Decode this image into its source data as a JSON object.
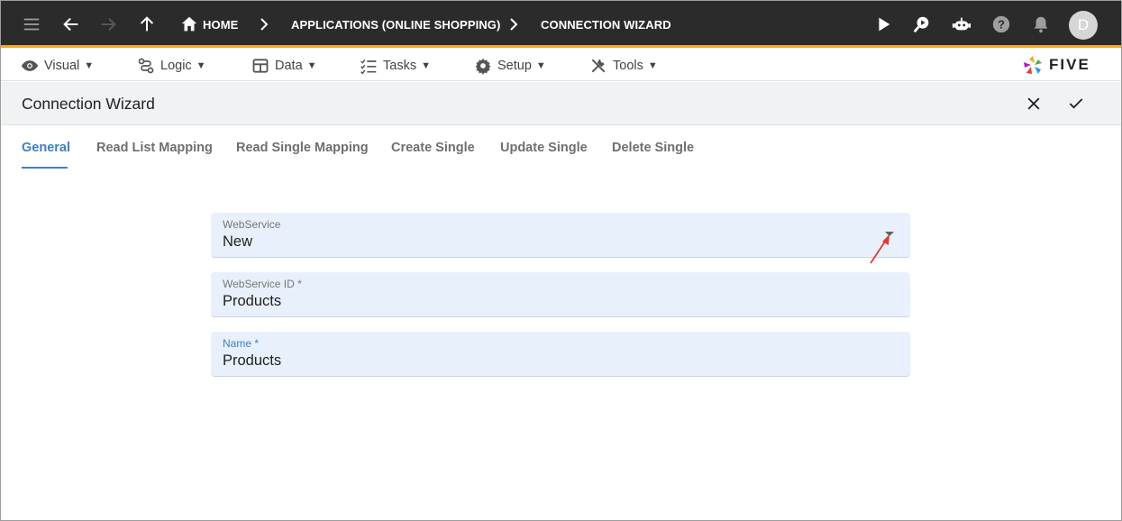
{
  "appbar": {
    "breadcrumbs": [
      {
        "label": "HOME"
      },
      {
        "label": "APPLICATIONS (ONLINE SHOPPING)"
      },
      {
        "label": "CONNECTION WIZARD"
      }
    ],
    "avatar_initial": "D",
    "icons": [
      "menu-icon",
      "back-arrow-icon",
      "forward-arrow-icon",
      "up-arrow-icon",
      "home-icon",
      "play-icon",
      "search-chat-icon",
      "bot-icon",
      "help-icon",
      "bell-icon"
    ]
  },
  "menubar": {
    "items": [
      {
        "label": "Visual",
        "icon": "eye-icon"
      },
      {
        "label": "Logic",
        "icon": "logic-icon"
      },
      {
        "label": "Data",
        "icon": "table-icon"
      },
      {
        "label": "Tasks",
        "icon": "checklist-icon"
      },
      {
        "label": "Setup",
        "icon": "gear-icon"
      },
      {
        "label": "Tools",
        "icon": "tools-icon"
      }
    ],
    "caret": "▼",
    "logo_text": "FIVE"
  },
  "header": {
    "title": "Connection Wizard"
  },
  "tabs": [
    {
      "label": "General",
      "active": true
    },
    {
      "label": "Read List Mapping"
    },
    {
      "label": "Read Single Mapping"
    },
    {
      "label": "Create Single"
    },
    {
      "label": "Update Single"
    },
    {
      "label": "Delete Single"
    }
  ],
  "form": {
    "webservice": {
      "label": "WebService",
      "value": "New"
    },
    "webservice_id": {
      "label": "WebService ID *",
      "value": "Products"
    },
    "name": {
      "label": "Name *",
      "value": "Products"
    }
  },
  "colors": {
    "appbar_bg": "#2b2b2b",
    "accent_orange": "#f5a623",
    "active_tab": "#3f7fc4",
    "field_bg": "#e8f1fb",
    "annotation_arrow": "#e53935"
  }
}
